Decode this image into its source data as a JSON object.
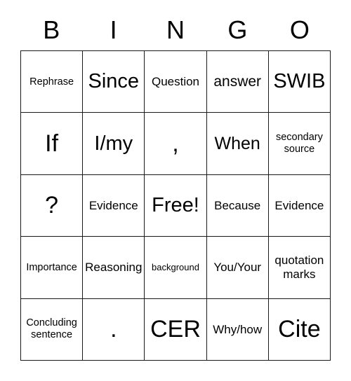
{
  "card": {
    "title": "BINGO",
    "header_letters": [
      "B",
      "I",
      "N",
      "G",
      "O"
    ],
    "columns": 5,
    "rows": 5,
    "border_color": "#1a1a1a",
    "background_color": "#ffffff",
    "text_color": "#000000",
    "free_space_label": "Free!",
    "free_space_position": {
      "row": 3,
      "column": 3
    },
    "grid": [
      [
        {
          "text": "Rephrase",
          "size": "xs"
        },
        {
          "text": "Since",
          "size": "xl"
        },
        {
          "text": "Question",
          "size": "sm"
        },
        {
          "text": "answer",
          "size": "md"
        },
        {
          "text": "SWIB",
          "size": "xl"
        }
      ],
      [
        {
          "text": "If",
          "size": "xxl"
        },
        {
          "text": "I/my",
          "size": "xl"
        },
        {
          "text": ",",
          "size": "xxl"
        },
        {
          "text": "When",
          "size": "lg"
        },
        {
          "text": "secondary source",
          "size": "xs"
        }
      ],
      [
        {
          "text": "?",
          "size": "xxl"
        },
        {
          "text": "Evidence",
          "size": "sm"
        },
        {
          "text": "Free!",
          "size": "xl"
        },
        {
          "text": "Because",
          "size": "sm"
        },
        {
          "text": "Evidence",
          "size": "sm"
        }
      ],
      [
        {
          "text": "Importance",
          "size": "xs"
        },
        {
          "text": "Reasoning",
          "size": "sm"
        },
        {
          "text": "background",
          "size": "xxs"
        },
        {
          "text": "You/Your",
          "size": "sm"
        },
        {
          "text": "quotation marks",
          "size": "sm"
        }
      ],
      [
        {
          "text": "Concluding sentence",
          "size": "xs"
        },
        {
          "text": ".",
          "size": "xxl"
        },
        {
          "text": "CER",
          "size": "xxl"
        },
        {
          "text": "Why/how",
          "size": "sm"
        },
        {
          "text": "Cite",
          "size": "xxl"
        }
      ]
    ]
  }
}
